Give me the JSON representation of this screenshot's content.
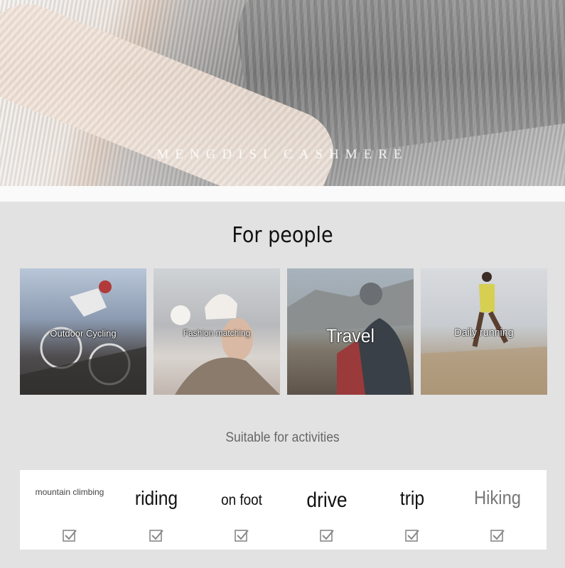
{
  "hero": {
    "brand": "MENGDISI CASHMERE"
  },
  "people": {
    "title": "For people",
    "cards": [
      {
        "label": "Outdoor Cycling"
      },
      {
        "label": "Fashion matching"
      },
      {
        "label": "Travel"
      },
      {
        "label": "Daily running"
      }
    ]
  },
  "activities": {
    "subtitle": "Suitable for activities",
    "items": [
      {
        "label": "mountain climbing",
        "checked": true
      },
      {
        "label": "riding",
        "checked": true
      },
      {
        "label": "on foot",
        "checked": true
      },
      {
        "label": "drive",
        "checked": true
      },
      {
        "label": "trip",
        "checked": true
      },
      {
        "label": "Hiking",
        "checked": true
      }
    ]
  }
}
